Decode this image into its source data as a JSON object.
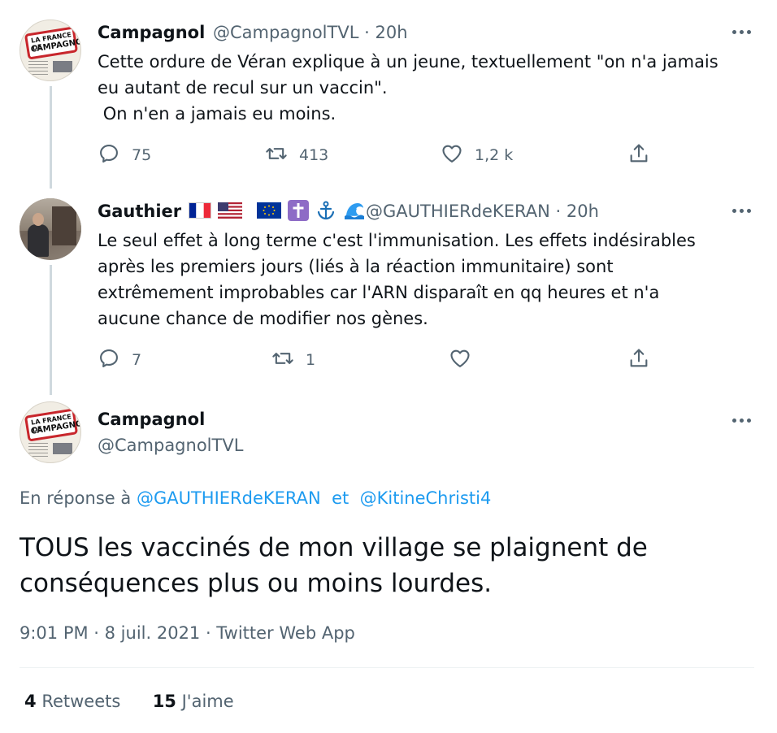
{
  "tweets": [
    {
      "display_name": "Campagnol",
      "handle": "@CampagnolTVL",
      "separator": "·",
      "time": "20h",
      "text": "Cette ordure de Véran explique à un jeune, textuellement \"on n'a jamais\neu autant de recul sur un vaccin\".\n On n'en a jamais eu moins.",
      "replies": "75",
      "retweets": "413",
      "likes": "1,2 k",
      "avatar_sign_line1": "LA FRANCE DE",
      "avatar_sign_line2": "CAMPAGNOL"
    },
    {
      "display_name": "Gauthier",
      "flags": [
        "flag-france-icon",
        "flag-usa-icon",
        "flag-eu-icon",
        "latin-cross-icon",
        "anchor-icon",
        "water-wave-icon"
      ],
      "handle": "@GAUTHIERdeKERAN",
      "separator": "·",
      "time": "20h",
      "text": "Le seul effet à long terme c'est l'immunisation. Les effets indésirables\naprès les premiers jours (liés à la réaction immunitaire) sont\nextrêmement improbables car l'ARN disparaît en qq heures et n'a\naucune chance de modifier nos gènes.",
      "replies": "7",
      "retweets": "1",
      "likes": ""
    }
  ],
  "focused": {
    "display_name": "Campagnol",
    "handle": "@CampagnolTVL",
    "avatar_sign_line1": "LA FRANCE DE",
    "avatar_sign_line2": "CAMPAGNOL",
    "reply_prefix": "En réponse à",
    "reply_user1": "@GAUTHIERdeKERAN",
    "reply_conj": "et",
    "reply_user2": "@KitineChristi4",
    "text": "TOUS les vaccinés de mon village se plaignent de conséquences plus ou moins lourdes.",
    "timestamp": "9:01 PM · 8 juil. 2021 · Twitter Web App",
    "retweets_count": "4",
    "retweets_label": "Retweets",
    "likes_count": "15",
    "likes_label": "J'aime"
  },
  "colors": {
    "text_primary": "#0f1419",
    "text_secondary": "#536471",
    "link": "#1d9bf0",
    "thread_line": "#cfd9de",
    "divider": "#eff3f4"
  }
}
